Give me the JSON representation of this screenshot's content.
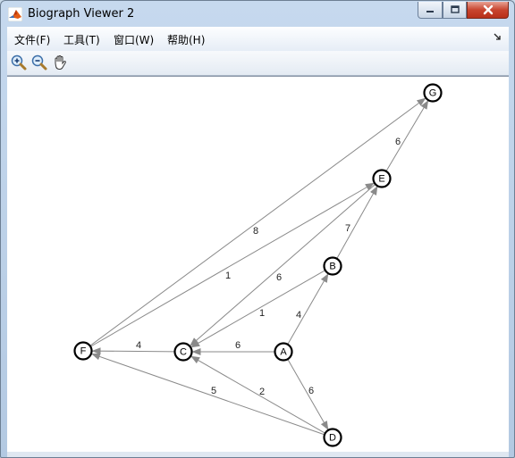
{
  "window": {
    "title": "Biograph Viewer 2"
  },
  "menu": {
    "items": [
      {
        "label": "文件(F)"
      },
      {
        "label": "工具(T)"
      },
      {
        "label": "窗口(W)"
      },
      {
        "label": "帮助(H)"
      }
    ]
  },
  "toolbar": {
    "icons": [
      "zoom-in-icon",
      "zoom-out-icon",
      "pan-hand-icon"
    ]
  },
  "graph": {
    "nodes": [
      {
        "id": "A"
      },
      {
        "id": "B"
      },
      {
        "id": "C"
      },
      {
        "id": "D"
      },
      {
        "id": "E"
      },
      {
        "id": "F"
      },
      {
        "id": "G"
      }
    ],
    "edges": [
      {
        "from": "A",
        "to": "B",
        "weight": "4"
      },
      {
        "from": "A",
        "to": "C",
        "weight": "6"
      },
      {
        "from": "A",
        "to": "D",
        "weight": "6"
      },
      {
        "from": "B",
        "to": "C",
        "weight": "1"
      },
      {
        "from": "B",
        "to": "E",
        "weight": "7"
      },
      {
        "from": "C",
        "to": "F",
        "weight": "4"
      },
      {
        "from": "D",
        "to": "C",
        "weight": "2"
      },
      {
        "from": "D",
        "to": "F",
        "weight": "5"
      },
      {
        "from": "E",
        "to": "C",
        "weight": "6"
      },
      {
        "from": "E",
        "to": "G",
        "weight": "6"
      },
      {
        "from": "F",
        "to": "E",
        "weight": "1"
      },
      {
        "from": "F",
        "to": "G",
        "weight": "8"
      }
    ],
    "colors": {
      "edge": "#8a8a8a",
      "node_border": "#000000",
      "node_fill": "#ffffff"
    }
  }
}
